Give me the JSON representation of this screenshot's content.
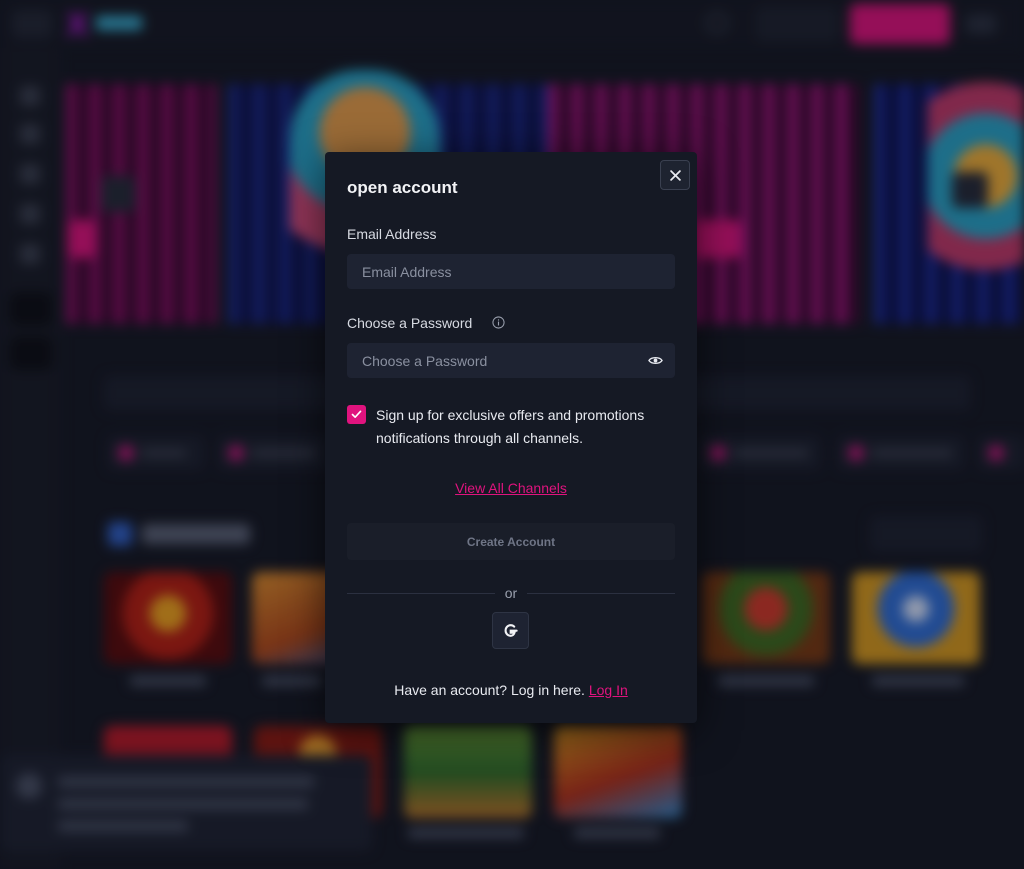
{
  "modal": {
    "title": "open account",
    "close_icon": "close-icon",
    "email": {
      "label": "Email Address",
      "placeholder": "Email Address",
      "value": ""
    },
    "password": {
      "label": "Choose a Password",
      "placeholder": "Choose a Password",
      "value": "",
      "info_icon": "info-icon",
      "toggle_icon": "eye-icon"
    },
    "offers_checkbox": {
      "checked": true,
      "text": "Sign up for exclusive offers and promotions notifications through all channels."
    },
    "view_channels_link": "View All Channels",
    "create_button": "Create Account",
    "divider_text": "or",
    "google_icon": "google-icon",
    "login_prompt": "Have an account? Log in here.",
    "login_link": "Log In"
  },
  "colors": {
    "accent": "#e0137e",
    "background": "#151924",
    "input_bg": "#1e2332"
  }
}
